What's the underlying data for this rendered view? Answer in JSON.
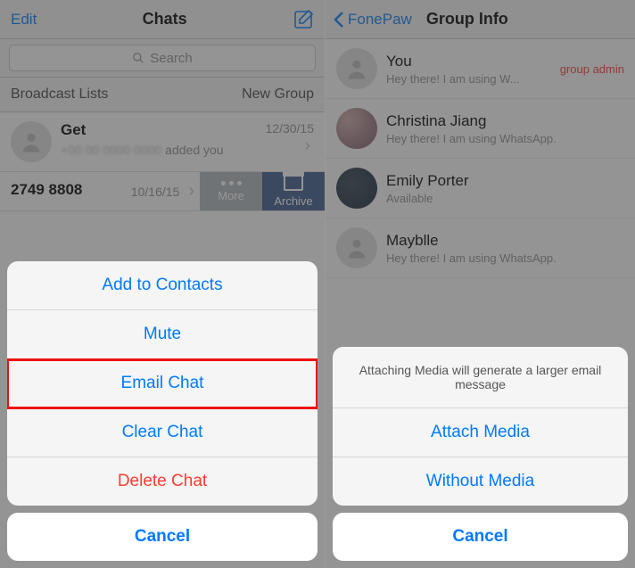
{
  "left": {
    "header": {
      "edit": "Edit",
      "title": "Chats"
    },
    "search_placeholder": "Search",
    "row2": {
      "broadcast": "Broadcast Lists",
      "newgroup": "New Group"
    },
    "chat1": {
      "name": "Get",
      "sub_suffix": " added you",
      "date": "12/30/15"
    },
    "chat2": {
      "number": "2749 8808",
      "date": "10/16/15"
    },
    "swipe": {
      "more": "More",
      "archive": "Archive"
    },
    "sheet": {
      "add": "Add to Contacts",
      "mute": "Mute",
      "email": "Email Chat",
      "clear": "Clear Chat",
      "delete": "Delete Chat",
      "cancel": "Cancel"
    }
  },
  "right": {
    "header": {
      "back": "FonePaw",
      "title": "Group Info"
    },
    "members": [
      {
        "name": "You",
        "sub": "Hey there! I am using W...",
        "badge": "group admin",
        "avatar": "default"
      },
      {
        "name": "Christina Jiang",
        "sub": "Hey there! I am using WhatsApp.",
        "avatar": "photo1"
      },
      {
        "name": "Emily Porter",
        "sub": "Available",
        "avatar": "photo2"
      },
      {
        "name": "Mayblle",
        "sub": "Hey there! I am using WhatsApp.",
        "avatar": "default"
      }
    ],
    "sheet": {
      "message": "Attaching Media will generate a larger email message",
      "attach": "Attach Media",
      "without": "Without Media",
      "cancel": "Cancel"
    }
  }
}
